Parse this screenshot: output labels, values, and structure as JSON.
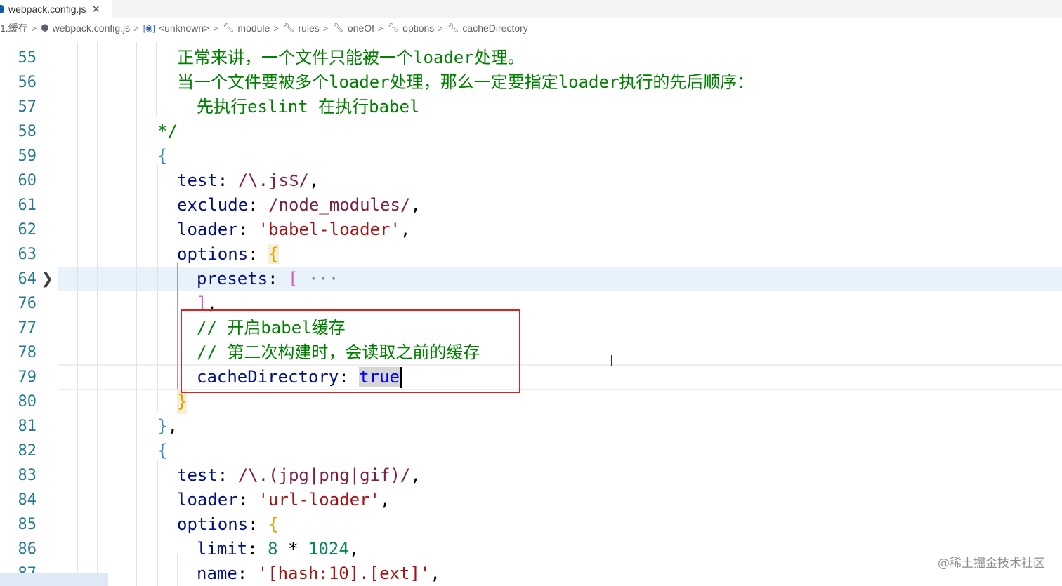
{
  "tab": {
    "filename": "webpack.config.js",
    "close_glyph": "✕"
  },
  "breadcrumb": [
    {
      "label": "1.缓存",
      "icon": "folder-icon"
    },
    {
      "label": "webpack.config.js",
      "icon": "js-file-icon"
    },
    {
      "label": "<unknown>",
      "icon": "variable-icon"
    },
    {
      "label": "module",
      "icon": "wrench-icon"
    },
    {
      "label": "rules",
      "icon": "wrench-icon"
    },
    {
      "label": "oneOf",
      "icon": "wrench-icon"
    },
    {
      "label": "options",
      "icon": "wrench-icon"
    },
    {
      "label": "cacheDirectory",
      "icon": "wrench-icon"
    }
  ],
  "lines": {
    "l55": {
      "n": "55",
      "t": "正常来讲，一个文件只能被一个loader处理。"
    },
    "l56": {
      "n": "56",
      "t": "当一个文件要被多个loader处理，那么一定要指定loader执行的先后顺序："
    },
    "l57": {
      "n": "57",
      "t": "先执行eslint 在执行babel"
    },
    "l58": {
      "n": "58",
      "t": "*/"
    },
    "l59": {
      "n": "59",
      "t": "{"
    },
    "l60": {
      "n": "60",
      "key": "test",
      "val": "/\\.js$/"
    },
    "l61": {
      "n": "61",
      "key": "exclude",
      "val": "/node_modules/"
    },
    "l62": {
      "n": "62",
      "key": "loader",
      "val": "'babel-loader'"
    },
    "l63": {
      "n": "63",
      "key": "options",
      "val": "{"
    },
    "l64": {
      "n": "64",
      "key": "presets",
      "val": "[",
      "folded": "···"
    },
    "l76": {
      "n": "76",
      "t": "]"
    },
    "l77": {
      "n": "77",
      "t": "// 开启babel缓存"
    },
    "l78": {
      "n": "78",
      "t": "// 第二次构建时，会读取之前的缓存"
    },
    "l79": {
      "n": "79",
      "key": "cacheDirectory",
      "val": "true"
    },
    "l80": {
      "n": "80",
      "t": "}"
    },
    "l81": {
      "n": "81",
      "t": "}"
    },
    "l82": {
      "n": "82",
      "t": "{"
    },
    "l83": {
      "n": "83",
      "key": "test",
      "val1": "/\\.",
      "val2": "(jpg|png|gif)",
      "val3": "/"
    },
    "l84": {
      "n": "84",
      "key": "loader",
      "val": "'url-loader'"
    },
    "l85": {
      "n": "85",
      "key": "options",
      "val": "{"
    },
    "l86": {
      "n": "86",
      "key": "limit",
      "num1": "8",
      "op": "*",
      "num2": "1024"
    },
    "l87": {
      "n": "87",
      "key": "name",
      "val": "'[hash:10].[ext]'"
    }
  },
  "punct": {
    "colon": ": ",
    "comma": ","
  },
  "watermark": "@稀土掘金技术社区",
  "colors": {
    "redbox": "#e0201c",
    "line_number": "#237893",
    "comment": "#008000",
    "string": "#a31515"
  }
}
